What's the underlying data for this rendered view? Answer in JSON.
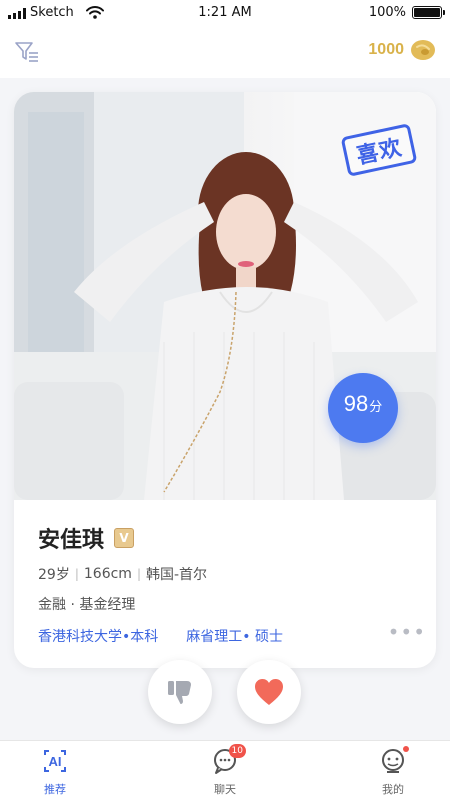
{
  "status_bar": {
    "carrier": "Sketch",
    "time": "1:21 AM",
    "battery": "100%",
    "battery_level": 1.0
  },
  "top_bar": {
    "filter_icon": "filter-icon",
    "coins": "1000",
    "coin_icon": "coin-bean-icon",
    "coin_color": "#d9b24a"
  },
  "card": {
    "stamp": "喜欢",
    "score_value": "98",
    "score_unit": "分",
    "name": "安佳琪",
    "verify_badge": "V",
    "age": "29岁",
    "height": "166cm",
    "location": "韩国-首尔",
    "job": "金融 · 基金经理",
    "education": [
      "香港科技大学•本科",
      "麻省理工• 硕士"
    ],
    "more": "•••"
  },
  "actions": {
    "dislike_icon": "thumbs-down-icon",
    "like_icon": "heart-icon"
  },
  "tabs": [
    {
      "label": "推荐",
      "icon": "ai-recommend-icon",
      "active": true
    },
    {
      "label": "聊天",
      "icon": "chat-bubble-icon",
      "badge": "10"
    },
    {
      "label": "我的",
      "icon": "profile-face-icon",
      "dot": true
    }
  ],
  "colors": {
    "accent": "#3d66e0",
    "score_bg": "#4d7af0",
    "heart": "#f26a5a",
    "badge": "#f0534a"
  }
}
